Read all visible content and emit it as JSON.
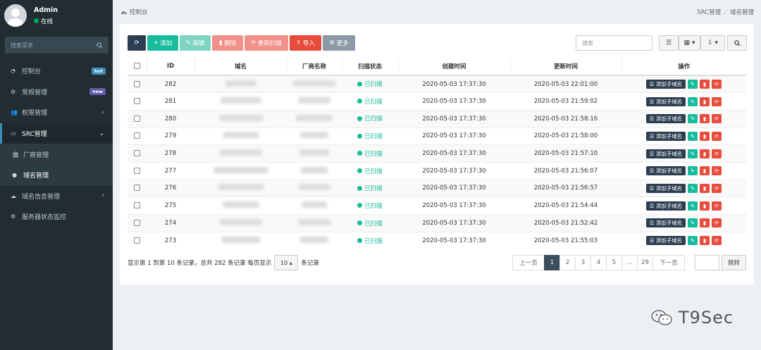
{
  "sidebar": {
    "user_name": "Admin",
    "user_status": "在线",
    "search_placeholder": "搜索菜单",
    "items": [
      {
        "icon": "dashboard-icon",
        "label": "控制台",
        "badge": "hot",
        "badge_color": "#3c8dbc"
      },
      {
        "icon": "cogs-icon",
        "label": "常规管理",
        "badge": "new",
        "badge_color": "#605ca8"
      },
      {
        "icon": "users-icon",
        "label": "权限管理",
        "arrow": "‹"
      },
      {
        "icon": "id-card-icon",
        "label": "SRC管理",
        "arrow": "⌄",
        "active": true
      },
      {
        "icon": "bank-icon",
        "label": "厂商管理",
        "sub": true
      },
      {
        "icon": "globe-icon",
        "label": "域名管理",
        "sub": true,
        "current": true
      },
      {
        "icon": "cloud-icon",
        "label": "域名信息管理",
        "arrow": "‹"
      },
      {
        "icon": "cogs-icon",
        "label": "服务器状态监控"
      }
    ]
  },
  "header": {
    "title": "控制台",
    "breadcrumb": [
      "SRC管理",
      "域名管理"
    ]
  },
  "toolbar": {
    "add": "添加",
    "edit": "编辑",
    "delete": "删除",
    "rescan": "重新扫描",
    "import": "导入",
    "more": "更多",
    "search_placeholder": "搜索"
  },
  "table": {
    "headers": [
      "ID",
      "域名",
      "厂商名称",
      "扫描状态",
      "创建时间",
      "更新时间",
      "操作"
    ],
    "add_sub_label": "添加子域名",
    "rows": [
      {
        "id": "282",
        "status": "已扫描",
        "created": "2020-05-03 17:37:30",
        "updated": "2020-05-03 22:01:00"
      },
      {
        "id": "281",
        "status": "已扫描",
        "created": "2020-05-03 17:37:30",
        "updated": "2020-05-03 21:59:02"
      },
      {
        "id": "280",
        "status": "已扫描",
        "created": "2020-05-03 17:37:30",
        "updated": "2020-05-03 21:58:16"
      },
      {
        "id": "279",
        "status": "已扫描",
        "created": "2020-05-03 17:37:30",
        "updated": "2020-05-03 21:58:00"
      },
      {
        "id": "278",
        "status": "已扫描",
        "created": "2020-05-03 17:37:30",
        "updated": "2020-05-03 21:57:10"
      },
      {
        "id": "277",
        "status": "已扫描",
        "created": "2020-05-03 17:37:30",
        "updated": "2020-05-03 21:56:07"
      },
      {
        "id": "276",
        "status": "已扫描",
        "created": "2020-05-03 17:37:30",
        "updated": "2020-05-03 21:56:57"
      },
      {
        "id": "275",
        "status": "已扫描",
        "created": "2020-05-03 17:37:30",
        "updated": "2020-05-03 21:54:44"
      },
      {
        "id": "274",
        "status": "已扫描",
        "created": "2020-05-03 17:37:30",
        "updated": "2020-05-03 21:52:42"
      },
      {
        "id": "273",
        "status": "已扫描",
        "created": "2020-05-03 17:37:30",
        "updated": "2020-05-03 21:55:03"
      }
    ]
  },
  "footer": {
    "info_prefix": "显示第 1 到第 10 条记录，总共 282 条记录 每页显示",
    "page_size": "10",
    "info_suffix": "条记录",
    "prev": "上一页",
    "pages": [
      "1",
      "2",
      "3",
      "4",
      "5",
      "...",
      "29"
    ],
    "next": "下一页",
    "jump": "跳转"
  },
  "watermark": "T9Sec"
}
